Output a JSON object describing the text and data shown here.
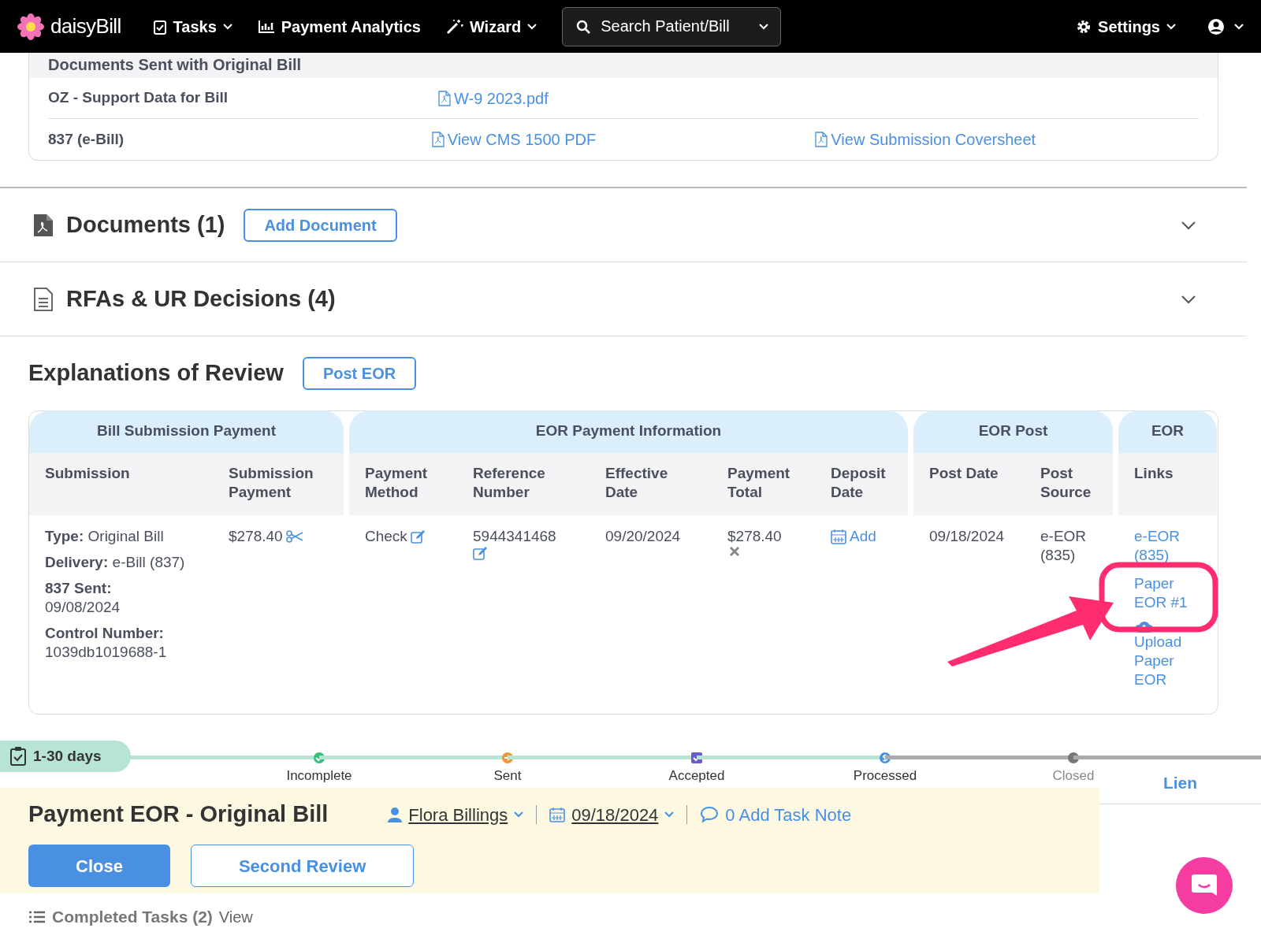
{
  "nav": {
    "logo": "daisyBill",
    "items": [
      {
        "label": "Tasks",
        "kind": "tasks",
        "has_menu": true
      },
      {
        "label": "Payment Analytics",
        "kind": "analytics",
        "has_menu": false
      },
      {
        "label": "Wizard",
        "kind": "wizard",
        "has_menu": true
      }
    ],
    "search": {
      "placeholder": "Search Patient/Bill"
    },
    "settings": {
      "label": "Settings"
    }
  },
  "documents_sent": {
    "title": "Documents Sent with Original Bill",
    "rows": [
      {
        "name": "OZ - Support Data for Bill",
        "links": [
          "W-9 2023.pdf"
        ]
      },
      {
        "name": "837 (e-Bill)",
        "links": [
          "View CMS 1500 PDF",
          "View Submission Coversheet"
        ]
      }
    ]
  },
  "sections": [
    {
      "kind": "pdf",
      "title": "Documents (1)",
      "button": "Add Document",
      "expanded": false
    },
    {
      "kind": "doc",
      "title": "RFAs & UR Decisions (4)",
      "expanded": false
    }
  ],
  "eor": {
    "title": "Explanations of Review",
    "button": "Post EOR",
    "groups": [
      {
        "title": "Bill Submission Payment",
        "columns": [
          {
            "label": "Submission",
            "cell": {
              "kind": "fields",
              "fields": [
                {
                  "label": "Type:",
                  "value": "Original Bill",
                  "kind": "inline"
                },
                {
                  "label": "Delivery:",
                  "value": "e-Bill (837)",
                  "kind": "inline"
                },
                {
                  "label": "837 Sent:",
                  "value": "09/08/2024",
                  "kind": "stacked"
                },
                {
                  "label": "Control Number:",
                  "value": "1039db1019688-1",
                  "kind": "stacked"
                }
              ]
            }
          },
          {
            "label": "Submission Payment",
            "cell": {
              "kind": "split",
              "text": "$278.40"
            }
          }
        ]
      },
      {
        "title": "EOR Payment Information",
        "columns": [
          {
            "label": "Payment Method",
            "cell": {
              "kind": "editable",
              "text": "Check"
            }
          },
          {
            "label": "Reference Number",
            "cell": {
              "kind": "editable_below",
              "text": "5944341468"
            }
          },
          {
            "label": "Effective Date",
            "cell": {
              "kind": "text",
              "text": "09/20/2024"
            }
          },
          {
            "label": "Payment Total",
            "cell": {
              "kind": "removable",
              "text": "$278.40"
            }
          },
          {
            "label": "Deposit Date",
            "cell": {
              "kind": "add",
              "text": "Add"
            }
          }
        ]
      },
      {
        "title": "EOR Post",
        "columns": [
          {
            "label": "Post Date",
            "cell": {
              "kind": "text",
              "text": "09/18/2024"
            }
          },
          {
            "label": "Post Source",
            "cell": {
              "kind": "text",
              "text": "e-EOR (835)"
            }
          }
        ]
      },
      {
        "title": "EOR",
        "columns": [
          {
            "label": "Links",
            "cell": {
              "kind": "links",
              "links": [
                {
                  "text": "e-EOR (835)",
                  "kind": "link"
                },
                {
                  "text": "Paper EOR #1",
                  "kind": "link"
                },
                {
                  "text": "Upload Paper EOR",
                  "kind": "upload"
                }
              ]
            }
          }
        ]
      }
    ]
  },
  "task": {
    "age": "1-30 days",
    "stages": [
      {
        "label": "Incomplete",
        "kind": "check",
        "reached": true
      },
      {
        "label": "Sent",
        "kind": "arrow",
        "reached": true
      },
      {
        "label": "Accepted",
        "kind": "task",
        "reached": true
      },
      {
        "label": "Processed",
        "kind": "dollar",
        "reached": true
      },
      {
        "label": "Closed",
        "kind": "dot",
        "reached": false
      }
    ],
    "title": "Payment EOR - Original Bill",
    "assignee": "Flora Billings",
    "date": "09/18/2024",
    "note": "0 Add Task Note",
    "buttons": [
      {
        "label": "Close",
        "kind": "primary"
      },
      {
        "label": "Second Review",
        "kind": "outline"
      }
    ],
    "side_tab": "Lien"
  },
  "completed": {
    "label": "Completed Tasks (2)",
    "link": "View"
  }
}
